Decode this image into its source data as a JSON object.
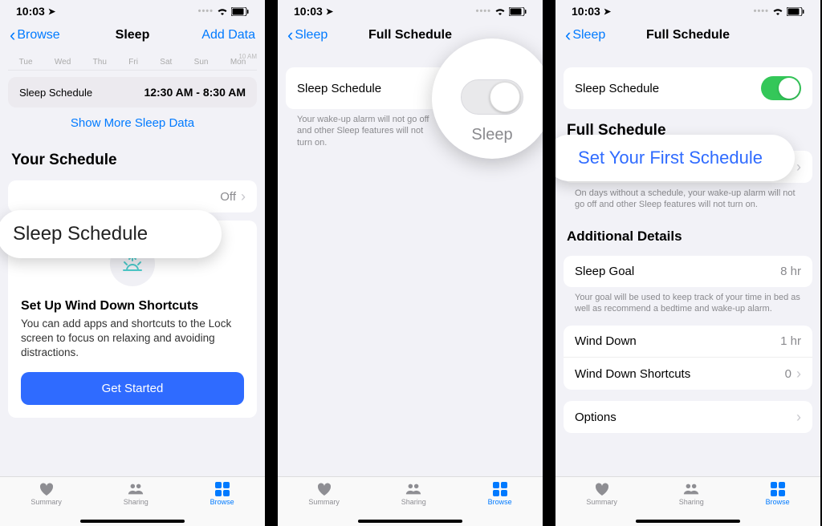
{
  "status": {
    "time": "10:03",
    "location_indicator": "↗",
    "signal": "....",
    "wifi": true,
    "battery": 85
  },
  "tabs": {
    "summary": "Summary",
    "sharing": "Sharing",
    "browse": "Browse"
  },
  "screen1": {
    "nav_back": "Browse",
    "nav_title": "Sleep",
    "nav_right": "Add Data",
    "weekdays": [
      "Tue",
      "Wed",
      "Thu",
      "Fri",
      "Sat",
      "Sun",
      "Mon"
    ],
    "top_right_label": "10 AM",
    "sleep_schedule_label": "Sleep Schedule",
    "sleep_schedule_time": "12:30 AM - 8:30 AM",
    "show_more": "Show More Sleep Data",
    "your_schedule": "Your Schedule",
    "row_value": "Off",
    "wind_title": "Set Up Wind Down Shortcuts",
    "wind_desc": "You can add apps and shortcuts to the Lock screen to focus on relaxing and avoiding distractions.",
    "get_started": "Get Started",
    "callout": "Sleep Schedule"
  },
  "screen2": {
    "nav_back": "Sleep",
    "nav_title": "Full Schedule",
    "toggle_label": "Sleep Schedule",
    "toggle_footer": "Your wake-up alarm will not go off and other Sleep features will not turn on.",
    "mag_label": "Sleep"
  },
  "screen3": {
    "nav_back": "Sleep",
    "nav_title": "Full Schedule",
    "toggle_label": "Sleep Schedule",
    "full_schedule_header": "Full Schedule",
    "set_first": "Set Your First Schedule",
    "footer1": "On days without a schedule, your wake-up alarm will not go off and other Sleep features will not turn on.",
    "additional_header": "Additional Details",
    "sleep_goal_label": "Sleep Goal",
    "sleep_goal_value": "8 hr",
    "sleep_goal_footer": "Your goal will be used to keep track of your time in bed as well as recommend a bedtime and wake-up alarm.",
    "wind_down_label": "Wind Down",
    "wind_down_value": "1 hr",
    "wind_short_label": "Wind Down Shortcuts",
    "wind_short_value": "0",
    "options_label": "Options",
    "callout": "Set Your First Schedule"
  }
}
